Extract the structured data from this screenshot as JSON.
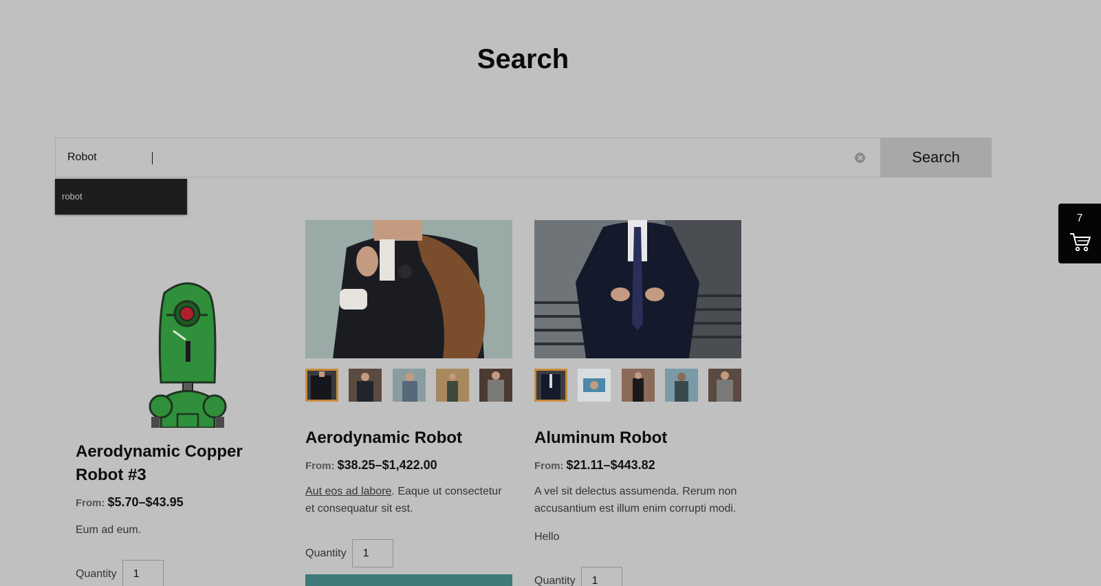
{
  "page": {
    "title": "Search"
  },
  "search": {
    "value": "Robot",
    "button_label": "Search"
  },
  "suggestions": [
    {
      "label": "robot"
    }
  ],
  "cart": {
    "count": "7"
  },
  "products": [
    {
      "title": "Aerodynamic Copper Robot #3",
      "from_label": "From:",
      "price": "$5.70–$43.95",
      "description": "Eum ad eum.",
      "quantity_label": "Quantity",
      "quantity": "1"
    },
    {
      "title": "Aerodynamic Robot",
      "from_label": "From:",
      "price": "$38.25–$1,422.00",
      "description_link": "Aut eos ad labore",
      "description": ". Eaque ut consectetur et consequatur sit est.",
      "quantity_label": "Quantity",
      "quantity": "1"
    },
    {
      "title": "Aluminum Robot",
      "from_label": "From:",
      "price": "$21.11–$443.82",
      "description": "A vel sit delectus assumenda. Rerum non accusantium est illum enim corrupti modi.",
      "extra": "Hello",
      "quantity_label": "Quantity",
      "quantity": "1"
    }
  ],
  "colors": {
    "background": "#c0c0c0",
    "button": "#a8a8a8",
    "add_to_cart": "#3f7a78",
    "active_thumb": "#c98a3c",
    "cart_widget": "#050505"
  }
}
